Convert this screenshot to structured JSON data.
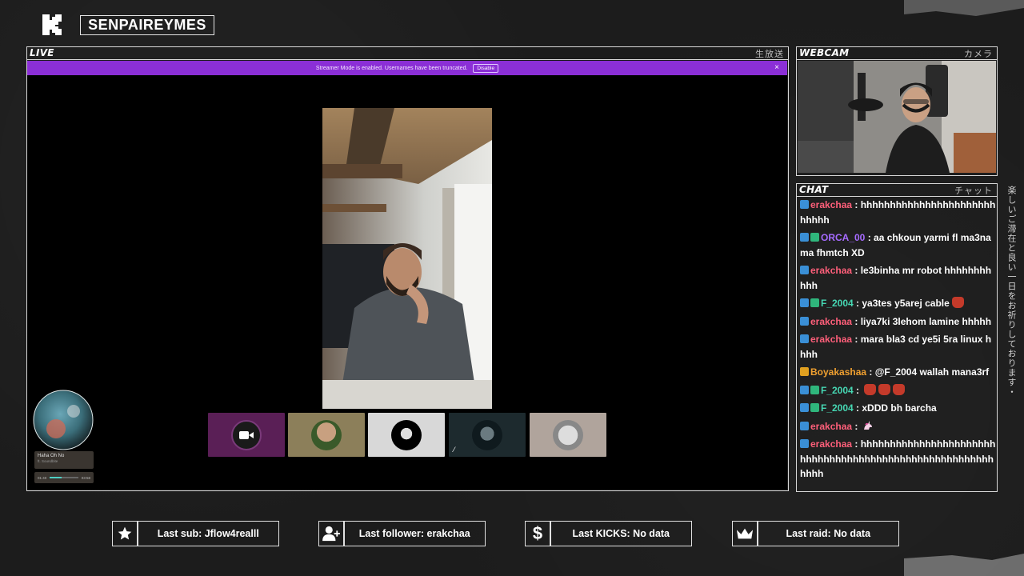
{
  "brand": {
    "logo_icon": "kick-logo-icon",
    "channel_name": "SENPAIREYMES"
  },
  "live": {
    "label": "LIVE",
    "jp_label": "生放送",
    "streamer_mode_text": "Streamer Mode is enabled. Usernames have been truncated.",
    "disable_label": "Disable",
    "close_icon": "close-icon",
    "close_glyph": "×"
  },
  "music": {
    "title": "Haha Oh No",
    "artist": "ft. Soundbite",
    "elapsed": "01:40",
    "duration": "03:58",
    "progress": 0.42
  },
  "webcam": {
    "label": "WEBCAM",
    "jp_label": "カメラ"
  },
  "chat": {
    "label": "CHAT",
    "jp_label": "チャット",
    "messages": [
      {
        "user": "erakchaa",
        "color": "#ff5f7a",
        "badges": [
          "blue"
        ],
        "text": "hhhhhhhhhhhhhhhhhhhhhhhhhhhh",
        "emotes": 0,
        "unicorn": false
      },
      {
        "user": "ORCA_00",
        "color": "#a66bff",
        "badges": [
          "blue",
          "green"
        ],
        "text": "aa chkoun yarmi fl ma3na ma fhmtch XD",
        "emotes": 0,
        "unicorn": false
      },
      {
        "user": "erakchaa",
        "color": "#ff5f7a",
        "badges": [
          "blue"
        ],
        "text": "le3binha mr robot hhhhhhhhhhh",
        "emotes": 0,
        "unicorn": false
      },
      {
        "user": "F_2004",
        "color": "#46d7b3",
        "badges": [
          "blue",
          "green"
        ],
        "text": "ya3tes y5arej cable",
        "emotes": 1,
        "unicorn": false
      },
      {
        "user": "erakchaa",
        "color": "#ff5f7a",
        "badges": [
          "blue"
        ],
        "text": "liya7ki 3lehom lamine hhhhh",
        "emotes": 0,
        "unicorn": false
      },
      {
        "user": "erakchaa",
        "color": "#ff5f7a",
        "badges": [
          "blue"
        ],
        "text": "mara bla3 cd ye5i 5ra linux hhhh",
        "emotes": 0,
        "unicorn": false
      },
      {
        "user": "Boyakashaa",
        "color": "#f0a030",
        "badges": [
          "gold"
        ],
        "text": "@F_2004 wallah mana3rf",
        "emotes": 0,
        "unicorn": false
      },
      {
        "user": "F_2004",
        "color": "#46d7b3",
        "badges": [
          "blue",
          "green"
        ],
        "text": "",
        "emotes": 3,
        "unicorn": false
      },
      {
        "user": "F_2004",
        "color": "#46d7b3",
        "badges": [
          "blue",
          "green"
        ],
        "text": "xDDD bh barcha",
        "emotes": 0,
        "unicorn": false
      },
      {
        "user": "erakchaa",
        "color": "#ff5f7a",
        "badges": [
          "blue"
        ],
        "text": "",
        "emotes": 0,
        "unicorn": true
      },
      {
        "user": "erakchaa",
        "color": "#ff5f7a",
        "badges": [
          "blue"
        ],
        "text": "hhhhhhhhhhhhhhhhhhhhhhhhhhhhhhhhhhhhhhhhhhhhhhhhhhhhhhhhhhhh",
        "emotes": 0,
        "unicorn": false
      }
    ]
  },
  "side_text": "楽しいご滞在と良い一日をお祈りしております・",
  "stats": [
    {
      "icon": "star-icon",
      "text": "Last sub: Jflow4realll"
    },
    {
      "icon": "add-user-icon",
      "text": "Last follower: erakchaa"
    },
    {
      "icon": "dollar-icon",
      "text": "Last KICKS: No data"
    },
    {
      "icon": "crown-icon",
      "text": "Last raid: No data"
    }
  ],
  "colors": {
    "streamer_bar": "#8b2fd6",
    "frame": "#d8d8d8",
    "background": "#1c1c1c"
  }
}
